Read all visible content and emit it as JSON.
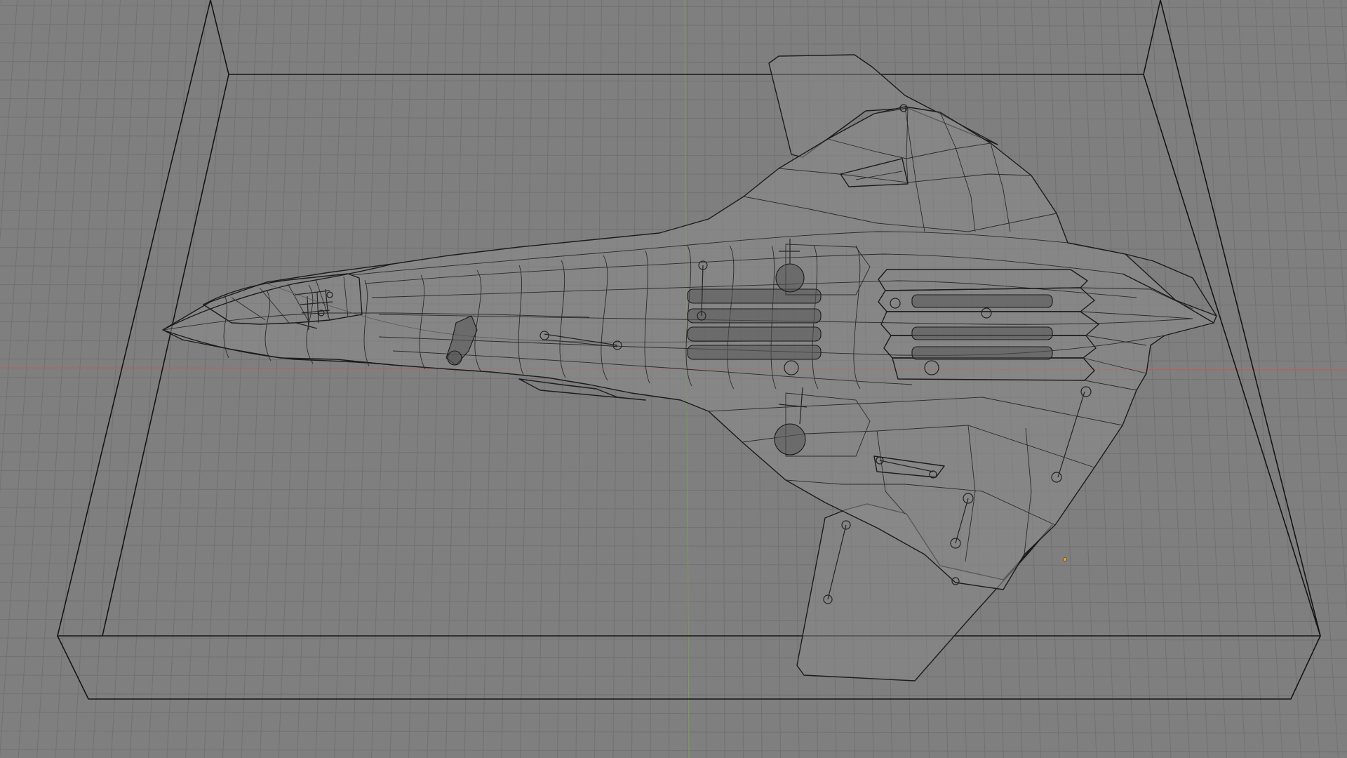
{
  "viewport": {
    "kind": "3D modeling viewport (wireframe view)",
    "colors": {
      "background": "#7f7f7f",
      "grid": "#717171",
      "axis_x": "#b4615b",
      "axis_y": "#7d9b5f",
      "wire": "#1b1b1b",
      "origin_marker": "#e0a73a"
    },
    "objects": [
      {
        "name": "aircraft-model",
        "shading": "wireframe"
      },
      {
        "name": "display-base-box",
        "shading": "wireframe"
      }
    ]
  }
}
